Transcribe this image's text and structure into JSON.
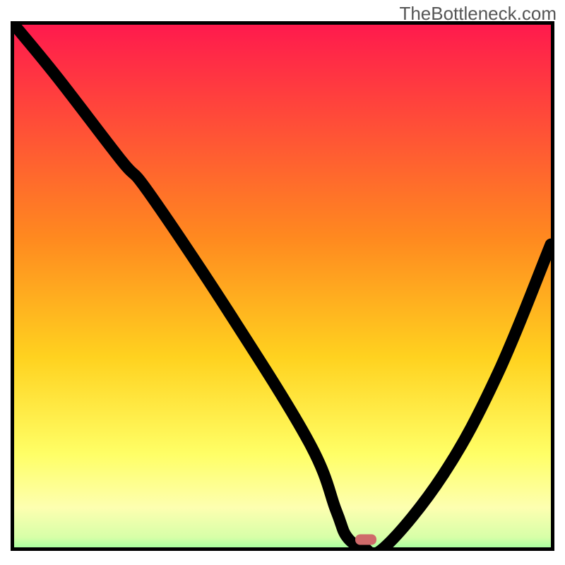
{
  "watermark": "TheBottleneck.com",
  "chart_data": {
    "type": "line",
    "title": "",
    "xlabel": "",
    "ylabel": "",
    "xlim": [
      0,
      100
    ],
    "ylim": [
      0,
      100
    ],
    "series": [
      {
        "name": "curve",
        "x": [
          0,
          8,
          20,
          25,
          40,
          55,
          60,
          62,
          65,
          69,
          80,
          90,
          100
        ],
        "y": [
          100,
          90,
          74,
          68,
          45,
          20,
          7,
          2,
          0,
          0,
          14,
          33,
          58
        ]
      }
    ],
    "marker": {
      "x": 65.5,
      "y": 1.5,
      "color": "#cf6a6a"
    },
    "gradient_stops": [
      {
        "offset": 0,
        "color": "#ff1a4d"
      },
      {
        "offset": 0.4,
        "color": "#ff8a1f"
      },
      {
        "offset": 0.62,
        "color": "#ffd21f"
      },
      {
        "offset": 0.8,
        "color": "#ffff66"
      },
      {
        "offset": 0.9,
        "color": "#fdffb0"
      },
      {
        "offset": 0.955,
        "color": "#d7ffa8"
      },
      {
        "offset": 0.985,
        "color": "#8fff99"
      },
      {
        "offset": 1.0,
        "color": "#00e86f"
      }
    ]
  }
}
